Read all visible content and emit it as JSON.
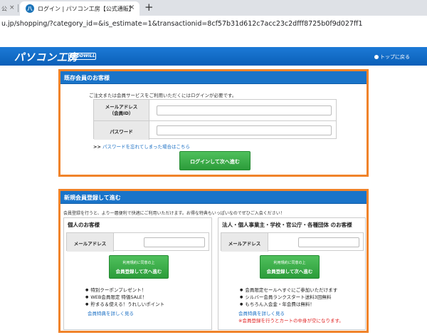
{
  "browser": {
    "prev_tab": "公",
    "tab_title": "ログイン | パソコン工房【公式通販】",
    "favicon": "八",
    "new_tab": "+",
    "close": "×",
    "url": "u.jp/shopping/?category_id=&is_estimate=1&transactionid=8cf57b31d612c7acc23c2dfff8725b0f9d027ff1"
  },
  "header": {
    "logo": "パソコン工房",
    "badge": "GOODWILL",
    "top_link": "トップに戻る"
  },
  "login": {
    "title": "既存会員のお客様",
    "note": "ご注文または会員サービスをご利用いただくにはログインが必要です。",
    "email_label_1": "メールアドレス",
    "email_label_2": "（会員ID）",
    "password_label": "パスワード",
    "forgot_arrows": ">>",
    "forgot_link": "パスワードを忘れてしまった場合はこちら",
    "submit": "ログインして次へ進む"
  },
  "register": {
    "title": "新規会員登録して進む",
    "note": "会員登録を行うと、より一層便利で快適にご利用いただけます。お得な特典もいっぱいなのでぜひご入会ください！",
    "individual": {
      "title": "個人のお客様",
      "email_label": "メールアドレス",
      "btn_small": "利用規約に同意の上",
      "btn_main": "会員登録して次へ進む",
      "benefits": [
        "特別クーポンプレゼント！",
        "WEB会員限定 特価SALE！",
        "貯まる＆使える！うれしいポイント"
      ],
      "link": "会員特典を詳しく見る"
    },
    "corporate": {
      "title": "法人・個人事業主・学校・官公庁・各種団体 のお客様",
      "email_label": "メールアドレス",
      "btn_small": "利用規約に同意の上",
      "btn_main": "会員登録して次へ進む",
      "benefits": [
        "会員限定セールへすぐにご参加いただけます",
        "シルバー会員ランクスタート送料3回無料",
        "もちろん入会金・年会費は無料！"
      ],
      "link": "会員特典を詳しく見る",
      "warning": "※会員登録を行うとカートの中身が空になります。"
    }
  },
  "colors": {
    "header_blue": "#0b5fb8",
    "panel_border": "#f0832a",
    "button_green": "#2c9c3a",
    "link_blue": "#1a6fc4",
    "warning_red": "#e02020"
  }
}
